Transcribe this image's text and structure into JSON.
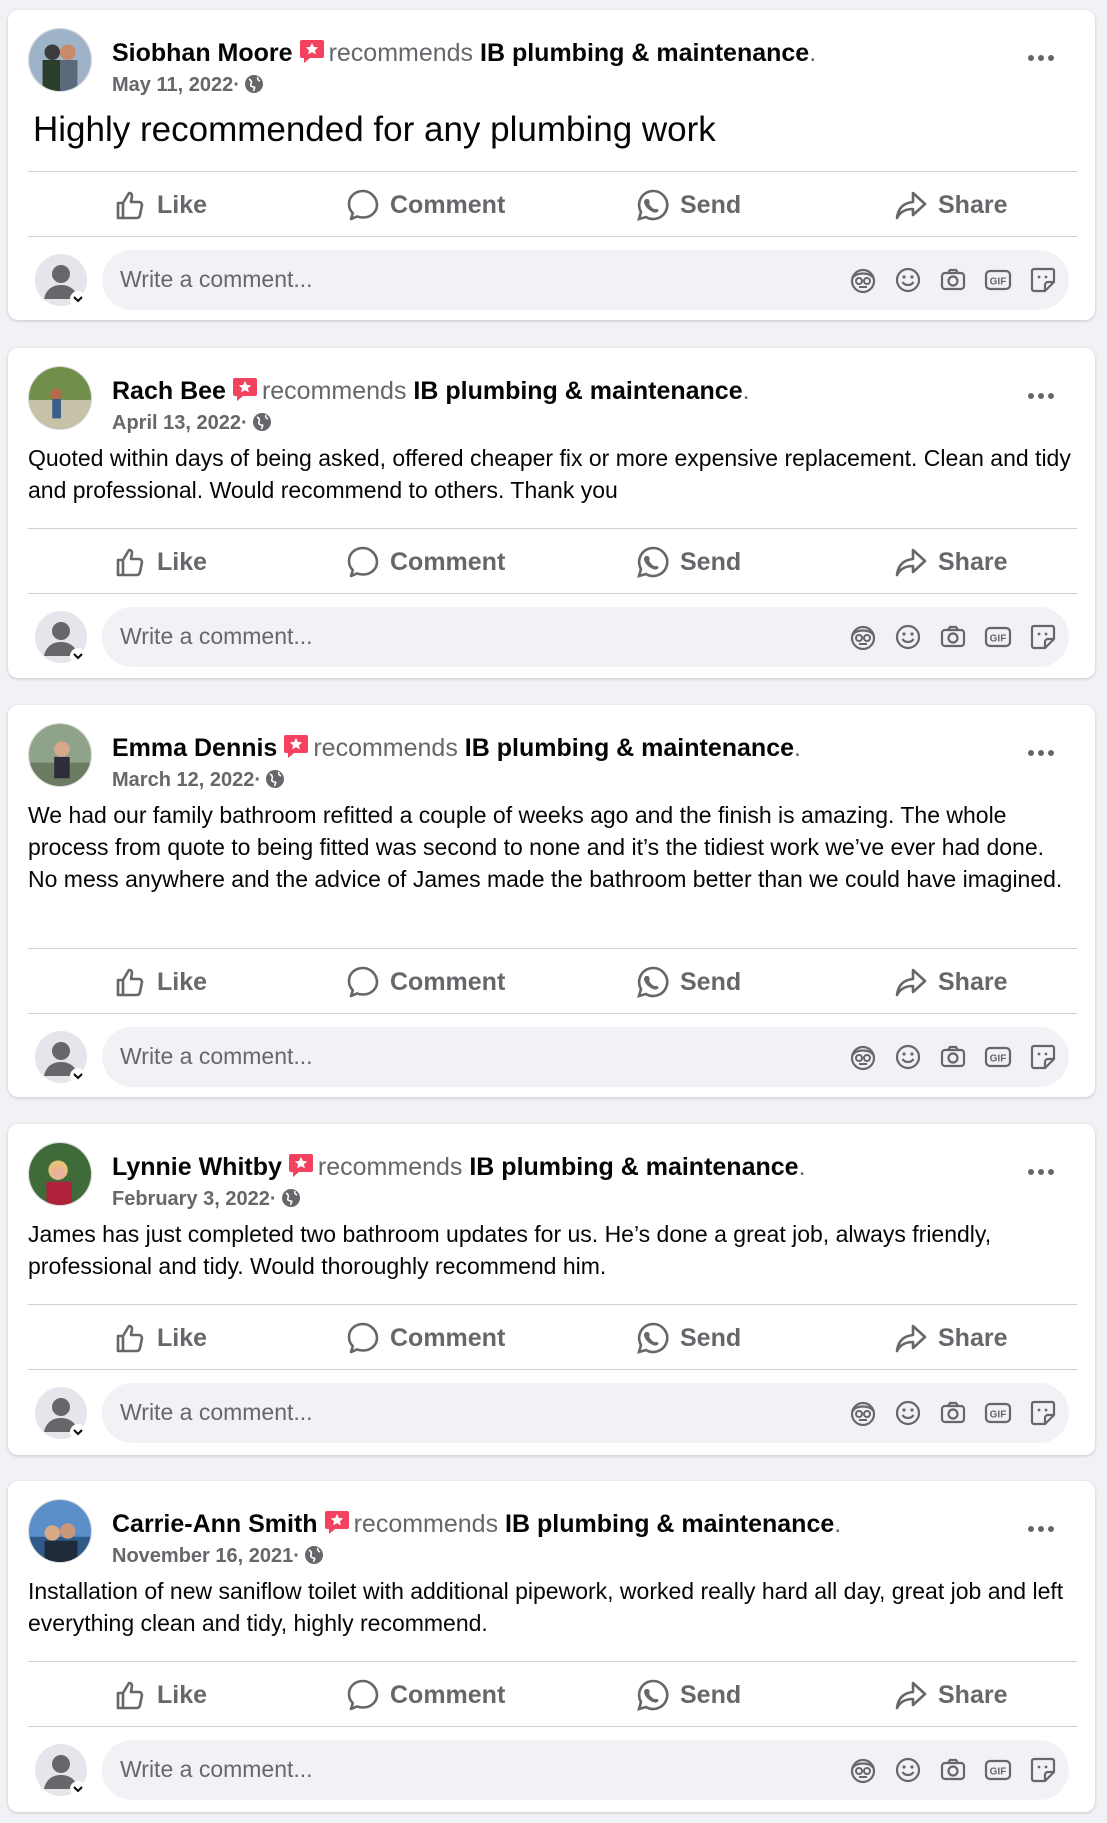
{
  "common": {
    "recommends_word": "recommends",
    "business_name": "IB plumbing & maintenance",
    "period": ".",
    "date_separator": "·",
    "comment_placeholder": "Write a comment...",
    "actions": {
      "like": "Like",
      "comment": "Comment",
      "send": "Send",
      "share": "Share"
    },
    "colors": {
      "text": "#050505",
      "secondary": "#65676b",
      "badge": "#f3425f",
      "card": "#ffffff",
      "page": "#f0f2f5"
    },
    "icons": [
      "thumbs-up-icon",
      "comment-icon",
      "whatsapp-icon",
      "share-icon",
      "avatar-sticker-icon",
      "emoji-icon",
      "camera-icon",
      "gif-icon",
      "sticker-icon",
      "globe-icon",
      "more-options-icon",
      "recommend-badge-icon"
    ]
  },
  "posts": [
    {
      "author": "Siobhan Moore",
      "date": "May 11, 2022",
      "text": "Highly recommended for any plumbing work"
    },
    {
      "author": "Rach Bee",
      "date": "April 13, 2022",
      "text": "Quoted within days of being asked, offered cheaper fix or more expensive replacement. Clean and tidy and professional. Would recommend to others. Thank you"
    },
    {
      "author": "Emma Dennis",
      "date": "March 12, 2022",
      "text": "We had our family bathroom refitted a couple of weeks ago and the finish is amazing. The whole process from quote to being fitted was second to none and it’s the tidiest work we’ve ever had done. No mess anywhere and the advice of James made  the bathroom better than we could have imagined."
    },
    {
      "author": "Lynnie Whitby",
      "date": "February 3, 2022",
      "text": "James has just completed two bathroom updates for us.  He’s done a great job, always friendly, professional and tidy.  Would thoroughly recommend him."
    },
    {
      "author": "Carrie-Ann Smith",
      "date": "November 16, 2021",
      "text": "Installation of new saniflow toilet with additional pipework, worked really hard all day, great job and left everything clean and tidy, highly recommend."
    }
  ]
}
